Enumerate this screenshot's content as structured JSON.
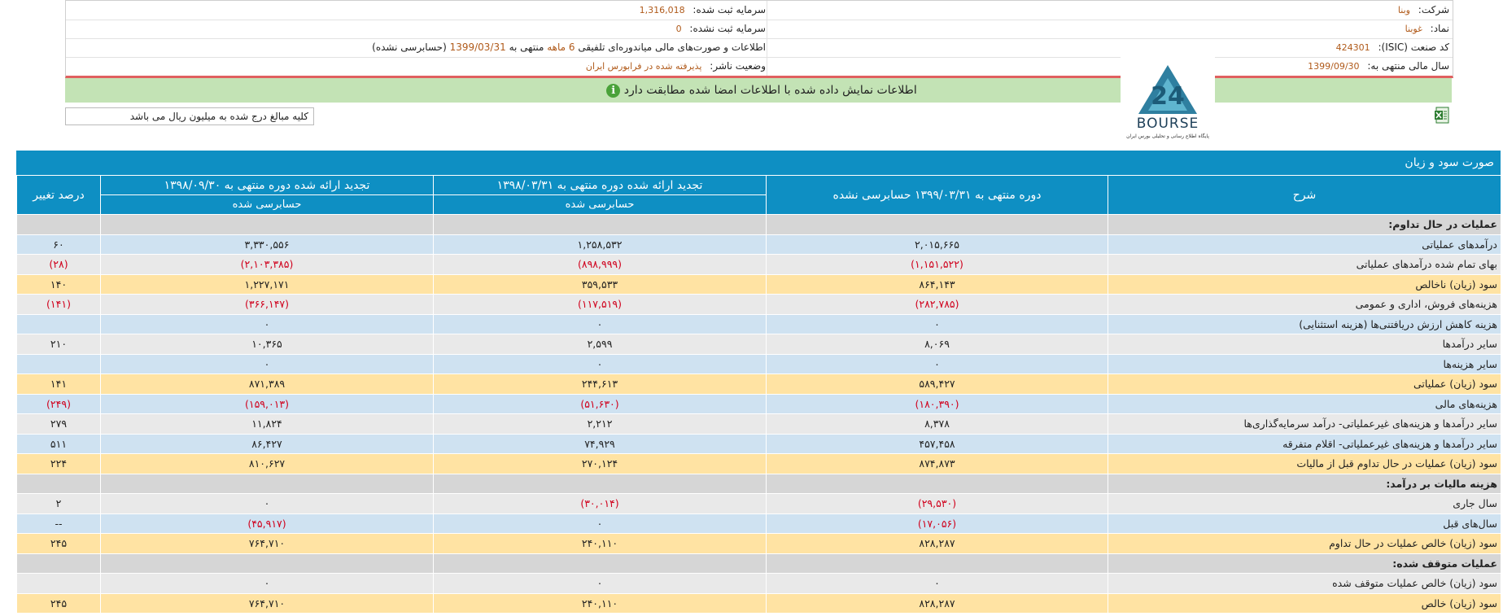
{
  "company_info": {
    "rows": [
      {
        "right_label": "شرکت:",
        "right_value": "وبنا",
        "left_label": "سرمایه ثبت شده:",
        "left_value": "1,316,018"
      },
      {
        "right_label": "نماد:",
        "right_value": "غوبنا",
        "left_label": "سرمایه ثبت نشده:",
        "left_value": "0"
      },
      {
        "right_label": "کد صنعت (ISIC):",
        "right_value": "424301",
        "left_label": "",
        "left_value": ""
      },
      {
        "right_label": "سال مالی منتهی به:",
        "right_value": "1399/09/30",
        "left_label": "وضعیت ناشر:",
        "left_value": "پذیرفته شده در فرابورس ایران"
      }
    ],
    "report_prefix": "اطلاعات و صورت‌های مالی میاندوره‌ای تلفیقی",
    "report_period": "6 ماهه",
    "report_mid": "منتهی به",
    "report_date": "1399/03/31",
    "report_suffix": "(حسابرسی نشده)"
  },
  "verification_banner": {
    "icon": "info-icon",
    "text": "اطلاعات نمایش داده شده با اطلاعات امضا شده مطابقت دارد"
  },
  "logo": {
    "text": "BOURSE",
    "numeral": "24",
    "caption": "پایگاه اطلاع رسانی و تحلیلی بورس ایران"
  },
  "unit_note": "کلیه مبالغ درج شده به میلیون ریال می باشد",
  "export_icon": "excel-icon",
  "table": {
    "title": "صورت سود و زیان",
    "headers": {
      "description": "شرح",
      "period_current": "دوره منتهی به ۱۳۹۹/۰۳/۳۱ حسابرسی نشده",
      "restated_1398_03": "تجدید ارائه شده دوره منتهی به ۱۳۹۸/۰۳/۳۱",
      "restated_1398_03_sub": "حسابرسی شده",
      "restated_1398_09": "تجدید ارائه شده دوره منتهی به ۱۳۹۸/۰۹/۳۰",
      "restated_1398_09_sub": "حسابرسی شده",
      "change_pct": "درصد تغییر"
    },
    "rows": [
      {
        "type": "section",
        "label": "عملیات در حال تداوم:",
        "c1": "",
        "c2": "",
        "c3": "",
        "c4": ""
      },
      {
        "type": "blue",
        "label": "درآمدهای عملیاتی",
        "c1": "۲,۰۱۵,۶۶۵",
        "c2": "۱,۲۵۸,۵۳۲",
        "c3": "۳,۳۳۰,۵۵۶",
        "c4": "۶۰"
      },
      {
        "type": "gray",
        "label": "بهای تمام شده درآمدهای عملیاتی",
        "c1": "(۱,۱۵۱,۵۲۲)",
        "c2": "(۸۹۸,۹۹۹)",
        "c3": "(۲,۱۰۳,۳۸۵)",
        "c4": "(۲۸)"
      },
      {
        "type": "yellow",
        "label": "سود (زیان) ناخالص",
        "c1": "۸۶۴,۱۴۳",
        "c2": "۳۵۹,۵۳۳",
        "c3": "۱,۲۲۷,۱۷۱",
        "c4": "۱۴۰"
      },
      {
        "type": "gray",
        "label": "هزینه‌های فروش، اداری و عمومی",
        "c1": "(۲۸۲,۷۸۵)",
        "c2": "(۱۱۷,۵۱۹)",
        "c3": "(۳۶۶,۱۴۷)",
        "c4": "(۱۴۱)"
      },
      {
        "type": "blue",
        "label": "هزینه کاهش ارزش دریافتنی‌ها (هزینه استثنایی)",
        "c1": "۰",
        "c2": "۰",
        "c3": "۰",
        "c4": ""
      },
      {
        "type": "gray",
        "label": "سایر درآمدها",
        "c1": "۸,۰۶۹",
        "c2": "۲,۵۹۹",
        "c3": "۱۰,۳۶۵",
        "c4": "۲۱۰"
      },
      {
        "type": "blue",
        "label": "سایر هزینه‌ها",
        "c1": "۰",
        "c2": "۰",
        "c3": "۰",
        "c4": ""
      },
      {
        "type": "yellow",
        "label": "سود (زیان) عملیاتی",
        "c1": "۵۸۹,۴۲۷",
        "c2": "۲۴۴,۶۱۳",
        "c3": "۸۷۱,۳۸۹",
        "c4": "۱۴۱"
      },
      {
        "type": "blue",
        "label": "هزینه‌های مالی",
        "c1": "(۱۸۰,۳۹۰)",
        "c2": "(۵۱,۶۳۰)",
        "c3": "(۱۵۹,۰۱۳)",
        "c4": "(۲۴۹)"
      },
      {
        "type": "gray",
        "label": "سایر درآمدها و هزینه‌های غیرعملیاتی- درآمد سرمایه‌گذاری‌ها",
        "c1": "۸,۳۷۸",
        "c2": "۲,۲۱۲",
        "c3": "۱۱,۸۲۴",
        "c4": "۲۷۹"
      },
      {
        "type": "blue",
        "label": "سایر درآمدها و هزینه‌های غیرعملیاتی- اقلام متفرقه",
        "c1": "۴۵۷,۴۵۸",
        "c2": "۷۴,۹۲۹",
        "c3": "۸۶,۴۲۷",
        "c4": "۵۱۱"
      },
      {
        "type": "yellow",
        "label": "سود (زیان) عملیات در حال تداوم قبل از مالیات",
        "c1": "۸۷۴,۸۷۳",
        "c2": "۲۷۰,۱۲۴",
        "c3": "۸۱۰,۶۲۷",
        "c4": "۲۲۴"
      },
      {
        "type": "section",
        "label": "هزینه مالیات بر درآمد:",
        "c1": "",
        "c2": "",
        "c3": "",
        "c4": ""
      },
      {
        "type": "gray",
        "label": "سال جاری",
        "c1": "(۲۹,۵۳۰)",
        "c2": "(۳۰,۰۱۴)",
        "c3": "۰",
        "c4": "۲"
      },
      {
        "type": "blue",
        "label": "سال‌های قبل",
        "c1": "(۱۷,۰۵۶)",
        "c2": "۰",
        "c3": "(۴۵,۹۱۷)",
        "c4": "--"
      },
      {
        "type": "yellow",
        "label": "سود (زیان) خالص عملیات در حال تداوم",
        "c1": "۸۲۸,۲۸۷",
        "c2": "۲۴۰,۱۱۰",
        "c3": "۷۶۴,۷۱۰",
        "c4": "۲۴۵"
      },
      {
        "type": "section",
        "label": "عملیات متوقف شده:",
        "c1": "",
        "c2": "",
        "c3": "",
        "c4": ""
      },
      {
        "type": "gray",
        "label": "سود (زیان) خالص عملیات متوقف شده",
        "c1": "۰",
        "c2": "۰",
        "c3": "۰",
        "c4": ""
      },
      {
        "type": "yellow",
        "label": "سود (زیان) خالص",
        "c1": "۸۲۸,۲۸۷",
        "c2": "۲۴۰,۱۱۰",
        "c3": "۷۶۴,۷۱۰",
        "c4": "۲۴۵"
      }
    ]
  }
}
